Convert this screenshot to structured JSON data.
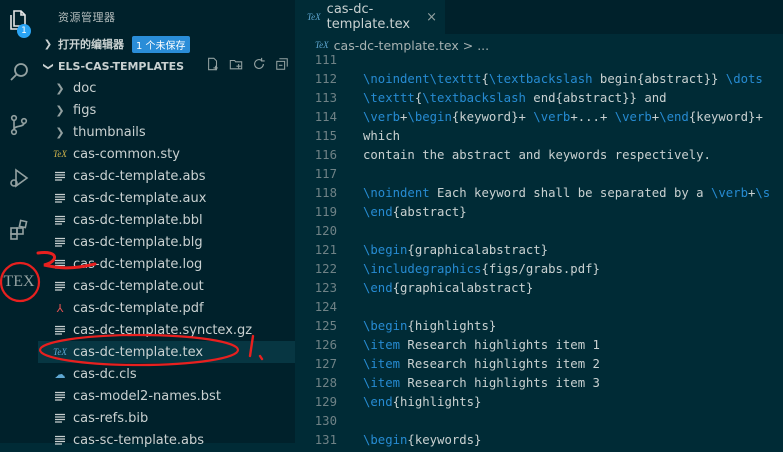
{
  "activity_bar": {
    "explorer_badge": "1",
    "tex_label": "TEX"
  },
  "sidebar": {
    "title": "资源管理器",
    "open_editors": {
      "label": "打开的编辑器",
      "badge": "1 个未保存"
    },
    "workspace": {
      "label": "ELS-CAS-TEMPLATES"
    },
    "items": [
      {
        "label": "doc",
        "icon": "chevron-right-icon"
      },
      {
        "label": "figs",
        "icon": "chevron-right-icon"
      },
      {
        "label": "thumbnails",
        "icon": "chevron-right-icon"
      },
      {
        "label": "cas-common.sty",
        "icon": "tex-file-icon"
      },
      {
        "label": "cas-dc-template.abs",
        "icon": "lines-file-icon"
      },
      {
        "label": "cas-dc-template.aux",
        "icon": "lines-file-icon"
      },
      {
        "label": "cas-dc-template.bbl",
        "icon": "lines-file-icon"
      },
      {
        "label": "cas-dc-template.blg",
        "icon": "lines-file-icon"
      },
      {
        "label": "cas-dc-template.log",
        "icon": "lines-file-icon"
      },
      {
        "label": "cas-dc-template.out",
        "icon": "lines-file-icon"
      },
      {
        "label": "cas-dc-template.pdf",
        "icon": "pdf-file-icon"
      },
      {
        "label": "cas-dc-template.synctex.gz",
        "icon": "lines-file-icon"
      },
      {
        "label": "cas-dc-template.tex",
        "icon": "tex-file-icon"
      },
      {
        "label": "cas-dc.cls",
        "icon": "cls-file-icon"
      },
      {
        "label": "cas-model2-names.bst",
        "icon": "lines-file-icon"
      },
      {
        "label": "cas-refs.bib",
        "icon": "lines-file-icon"
      },
      {
        "label": "cas-sc-template.abs",
        "icon": "lines-file-icon"
      }
    ]
  },
  "editor": {
    "tab": {
      "label": "cas-dc-template.tex",
      "close": "×"
    },
    "breadcrumb": {
      "file": "cas-dc-template.tex",
      "sep": ">",
      "more": "..."
    },
    "lines": [
      {
        "n": "111",
        "t": ""
      },
      {
        "n": "112",
        "t": "\\noindent\\texttt{\\textbackslash begin{abstract}} \\dots"
      },
      {
        "n": "113",
        "t": "\\texttt{\\textbackslash end{abstract}} and"
      },
      {
        "n": "114",
        "t": "\\verb+\\begin{keyword}+ \\verb+...+ \\verb+\\end{keyword}+"
      },
      {
        "n": "115",
        "t": "which"
      },
      {
        "n": "116",
        "t": "contain the abstract and keywords respectively."
      },
      {
        "n": "117",
        "t": ""
      },
      {
        "n": "118",
        "t": "\\noindent Each keyword shall be separated by a \\verb+\\s"
      },
      {
        "n": "119",
        "t": "\\end{abstract}"
      },
      {
        "n": "120",
        "t": ""
      },
      {
        "n": "121",
        "t": "\\begin{graphicalabstract}"
      },
      {
        "n": "122",
        "t": "\\includegraphics{figs/grabs.pdf}"
      },
      {
        "n": "123",
        "t": "\\end{graphicalabstract}"
      },
      {
        "n": "124",
        "t": ""
      },
      {
        "n": "125",
        "t": "\\begin{highlights}"
      },
      {
        "n": "126",
        "t": "\\item Research highlights item 1"
      },
      {
        "n": "127",
        "t": "\\item Research highlights item 2"
      },
      {
        "n": "128",
        "t": "\\item Research highlights item 3"
      },
      {
        "n": "129",
        "t": "\\end{highlights}"
      },
      {
        "n": "130",
        "t": ""
      },
      {
        "n": "131",
        "t": "\\begin{keywords}"
      }
    ]
  },
  "annotation": {
    "number": "1."
  }
}
